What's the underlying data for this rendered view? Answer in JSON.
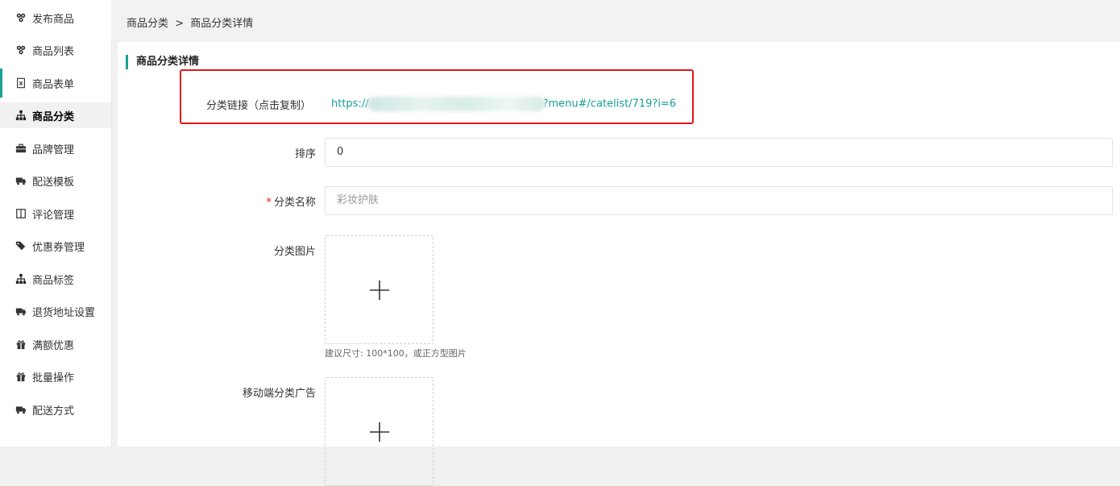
{
  "sidebar": {
    "items": [
      {
        "label": "发布商品",
        "icon": "cubes-icon"
      },
      {
        "label": "商品列表",
        "icon": "cubes-icon"
      },
      {
        "label": "商品表单",
        "icon": "file-excel-icon"
      },
      {
        "label": "商品分类",
        "icon": "sitemap-icon",
        "active": true
      },
      {
        "label": "品牌管理",
        "icon": "briefcase-icon"
      },
      {
        "label": "配送模板",
        "icon": "truck-icon"
      },
      {
        "label": "评论管理",
        "icon": "columns-icon"
      },
      {
        "label": "优惠券管理",
        "icon": "tags-icon"
      },
      {
        "label": "商品标签",
        "icon": "sitemap-icon"
      },
      {
        "label": "退货地址设置",
        "icon": "truck-icon"
      },
      {
        "label": "满额优惠",
        "icon": "gift-icon"
      },
      {
        "label": "批量操作",
        "icon": "gift-icon"
      },
      {
        "label": "配送方式",
        "icon": "truck-icon"
      }
    ]
  },
  "breadcrumb": {
    "parent": "商品分类",
    "separator": ">",
    "current": "商品分类详情"
  },
  "section": {
    "title": "商品分类详情"
  },
  "form": {
    "link_label": "分类链接（点击复制）",
    "link_prefix": "https://",
    "link_suffix": "?menu#/catelist/719?i=6",
    "sort_label": "排序",
    "sort_value": "0",
    "name_required_mark": "*",
    "name_label": "分类名称",
    "name_placeholder": "彩妆护肤",
    "image_label": "分类图片",
    "image_hint": "建议尺寸: 100*100，或正方型图片",
    "mobile_ad_label": "移动端分类广告"
  },
  "colors": {
    "accent": "#1aa094",
    "highlight": "#e0161c"
  }
}
